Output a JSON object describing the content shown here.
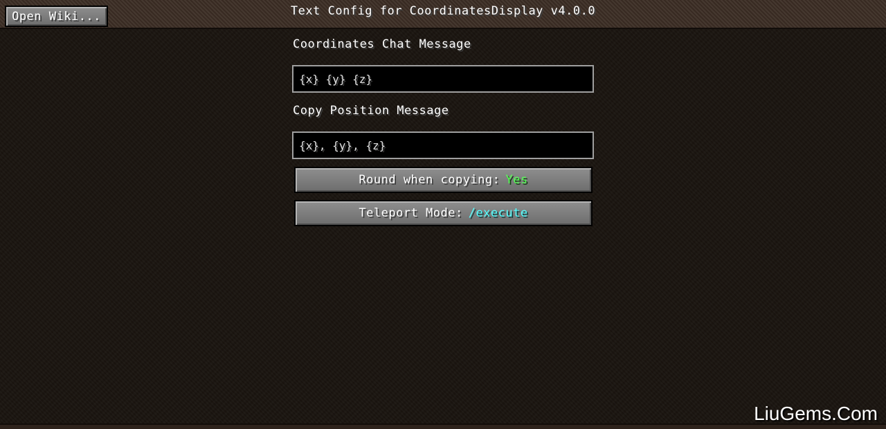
{
  "header": {
    "wiki_button_label": "Open Wiki...",
    "title": "Text Config for CoordinatesDisplay v4.0.0"
  },
  "fields": [
    {
      "label": "Coordinates Chat Message",
      "value": "{x} {y} {z}"
    },
    {
      "label": "Copy Position Message",
      "value": "{x}, {y}, {z}"
    }
  ],
  "options": [
    {
      "label": "Round when copying:",
      "value": "Yes",
      "value_color": "#55ff55"
    },
    {
      "label": "Teleport Mode:",
      "value": "/execute",
      "value_color": "#55ffff"
    }
  ],
  "watermark": "LiuGems.Com"
}
